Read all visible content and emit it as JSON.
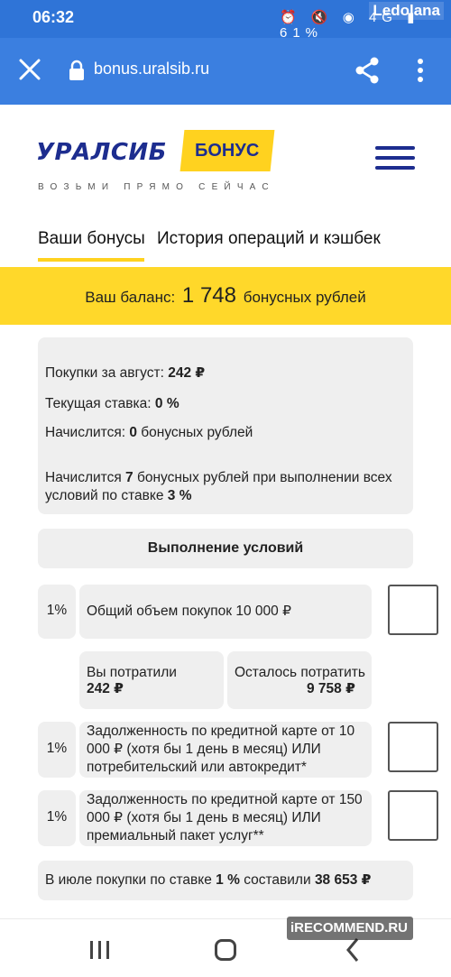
{
  "status_bar": {
    "time": "06:32",
    "icons": "⏰ 🔇 ◉ 4G ▮ 61%",
    "username": "Ledolana"
  },
  "app_bar": {
    "url": "bonus.uralsib.ru"
  },
  "logo": {
    "brand": "УРАЛСИБ",
    "badge": "БОНУС",
    "slogan": "ВОЗЬМИ ПРЯМО СЕЙЧАС"
  },
  "tabs": [
    {
      "label": "Ваши бонусы",
      "active": true
    },
    {
      "label": "История операций и кэшбек",
      "active": false
    }
  ],
  "balance": {
    "prefix": "Ваш баланс:",
    "amount": "1 748",
    "suffix": "бонусных рублей"
  },
  "summary": {
    "purchases_label": "Покупки за август:",
    "purchases_value": "242 ₽",
    "rate_label": "Текущая ставка:",
    "rate_value": "0 %",
    "accrue_label": "Начислится:",
    "accrue_value": "0",
    "accrue_suffix": "бонусных рублей",
    "note_prefix": "Начислится",
    "note_value": "7",
    "note_middle": "бонусных рублей при выполнении всех условий по ставке",
    "note_rate": "3 %"
  },
  "conditions": {
    "header": "Выполнение условий",
    "items": [
      {
        "percent": "1%",
        "text": "Общий объем покупок 10 000 ₽",
        "checked": false
      },
      {
        "percent": "1%",
        "text": "Задолженность по кредитной карте от 10 000 ₽ (хотя бы 1 день в месяц) ИЛИ потребительский или автокредит*",
        "checked": false
      },
      {
        "percent": "1%",
        "text": "Задолженность по кредитной карте от 150 000 ₽ (хотя бы 1 день в месяц) ИЛИ премиальный пакет услуг**",
        "checked": false
      }
    ],
    "spent_label": "Вы потратили",
    "spent_value": "242 ₽",
    "left_label": "Осталось потратить",
    "left_value": "9 758 ₽"
  },
  "footer_note": {
    "prefix": "В июле покупки по ставке",
    "rate": "1 %",
    "middle": "составили",
    "value": "38 653 ₽"
  },
  "watermark": "iRECOMMEND.RU",
  "colors": {
    "browser_bar": "#3b7fe0",
    "brand_blue": "#1d2d8f",
    "brand_yellow": "#ffd21f",
    "card_bg": "#efefef"
  }
}
